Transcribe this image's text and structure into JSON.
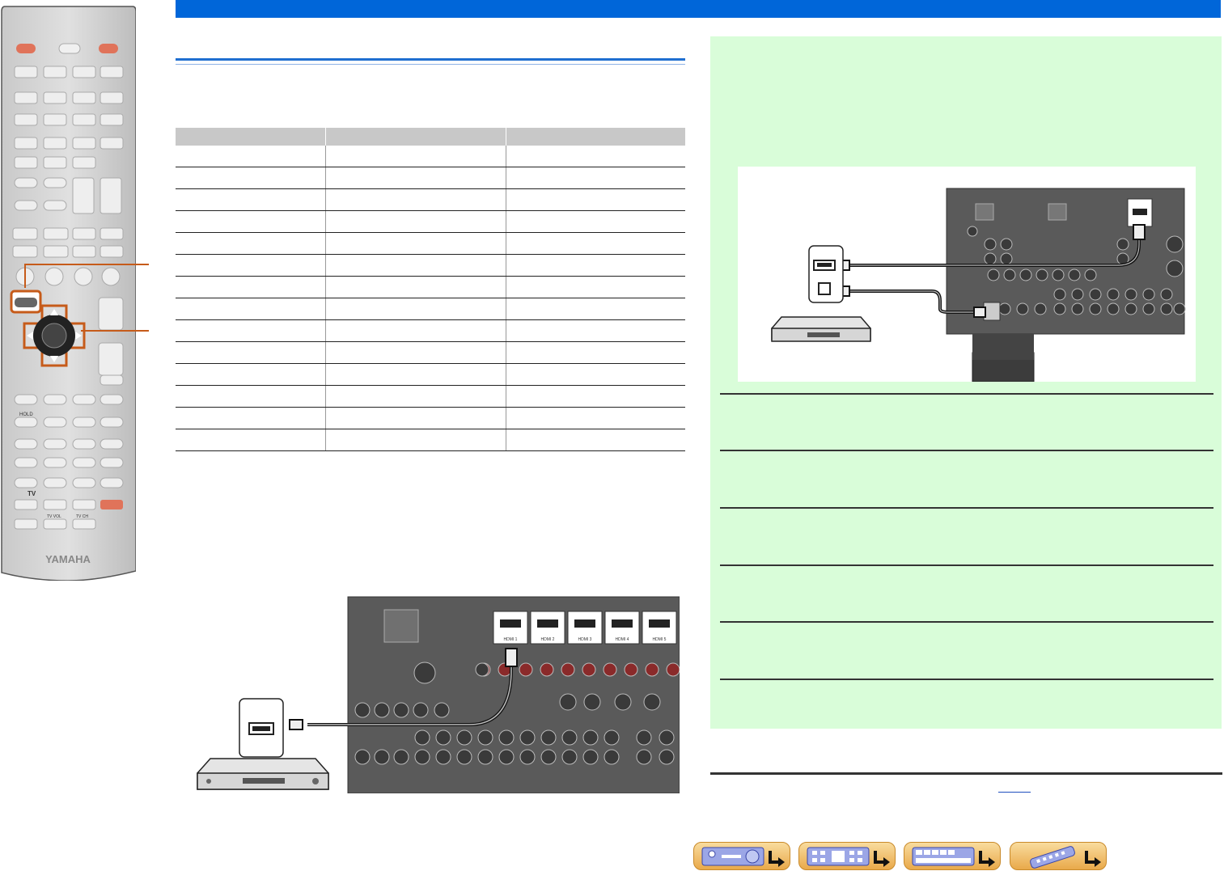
{
  "remote": {
    "brand": "YAMAHA",
    "labels": {
      "hold": "HOLD",
      "tv": "TV",
      "tv_vol": "TV VOL",
      "tv_ch": "TV CH"
    }
  },
  "table": {
    "headers": [
      "",
      "",
      ""
    ],
    "rows": [
      [
        "",
        "",
        ""
      ],
      [
        "",
        "",
        ""
      ],
      [
        "",
        "",
        ""
      ],
      [
        "",
        "",
        ""
      ],
      [
        "",
        "",
        ""
      ],
      [
        "",
        "",
        ""
      ],
      [
        "",
        "",
        ""
      ],
      [
        "",
        "",
        ""
      ],
      [
        "",
        "",
        ""
      ],
      [
        "",
        "",
        ""
      ],
      [
        "",
        "",
        ""
      ],
      [
        "",
        "",
        ""
      ],
      [
        "",
        "",
        ""
      ],
      [
        "",
        "",
        ""
      ]
    ]
  },
  "rear_panel": {
    "hdmi_ports": [
      "HDMI 1",
      "HDMI 2",
      "HDMI 3",
      "HDMI 4",
      "HDMI 5"
    ]
  },
  "colors": {
    "top_bar": "#0066d9",
    "panel_bg": "#d9fdd9",
    "callout": "#c65b1a",
    "nav_button": "#e9a94a"
  },
  "nav": {
    "buttons": [
      {
        "icon": "front-panel-icon"
      },
      {
        "icon": "rear-panel-icon"
      },
      {
        "icon": "display-icon"
      },
      {
        "icon": "remote-icon"
      }
    ]
  }
}
